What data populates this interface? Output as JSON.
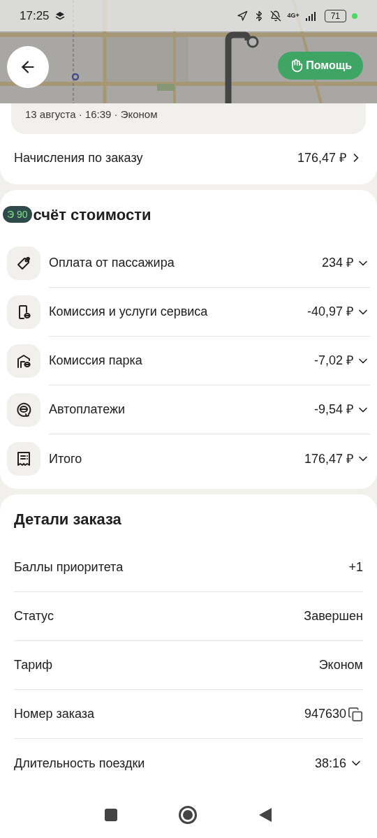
{
  "status_bar": {
    "time": "17:25",
    "network": "4G+",
    "battery": "71"
  },
  "header": {
    "help": "Помощь"
  },
  "order_summary": {
    "meta": "13 августа · 16:39 · Эконом"
  },
  "accruals": {
    "label": "Начисления по заказу",
    "value": "176,47 ₽"
  },
  "overlay_badge": "Э 90",
  "cost": {
    "title": "счёт стоимости",
    "rows": [
      {
        "kind": "tag",
        "label": "Оплата от пассажира",
        "value": "234 ₽"
      },
      {
        "kind": "phone",
        "label": "Комиссия и услуги сервиса",
        "value": "-40,97 ₽"
      },
      {
        "kind": "garage",
        "label": "Комиссия парка",
        "value": "-7,02 ₽"
      },
      {
        "kind": "auto",
        "label": "Автоплатежи",
        "value": "-9,54 ₽"
      },
      {
        "kind": "receipt",
        "label": "Итого",
        "value": "176,47 ₽"
      }
    ]
  },
  "details": {
    "title": "Детали заказа",
    "rows": [
      {
        "kind": "plain",
        "label": "Баллы приоритета",
        "value": "+1"
      },
      {
        "kind": "plain",
        "label": "Статус",
        "value": "Завершен"
      },
      {
        "kind": "plain",
        "label": "Тариф",
        "value": "Эконом"
      },
      {
        "kind": "copy",
        "label": "Номер заказа",
        "value": "947630"
      },
      {
        "kind": "expand",
        "label": "Длительность поездки",
        "value": "38:16"
      }
    ]
  }
}
